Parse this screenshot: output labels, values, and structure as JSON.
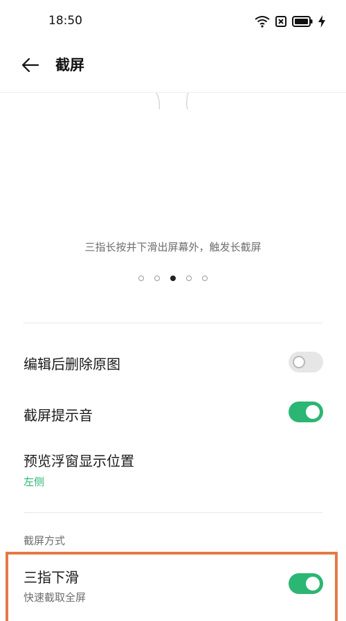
{
  "status_bar": {
    "time": "18:50",
    "icons": [
      "wifi-icon",
      "no-sim-icon",
      "battery-icon",
      "charging-icon"
    ]
  },
  "header": {
    "title": "截屏",
    "back_icon": "back-arrow-icon"
  },
  "preview": {
    "caption": "三指长按并下滑出屏幕外，触发长截屏",
    "page_count": 5,
    "active_page": 3
  },
  "settings": {
    "delete_original": {
      "label": "编辑后删除原图",
      "enabled": false
    },
    "screenshot_sound": {
      "label": "截屏提示音",
      "enabled": true
    },
    "preview_position": {
      "label": "预览浮窗显示位置",
      "value": "左侧"
    }
  },
  "methods": {
    "section_title": "截屏方式",
    "three_finger": {
      "label": "三指下滑",
      "sub": "快速截取全屏",
      "enabled": true
    }
  },
  "colors": {
    "accent": "#2bb673",
    "highlight": "#e57a46"
  }
}
